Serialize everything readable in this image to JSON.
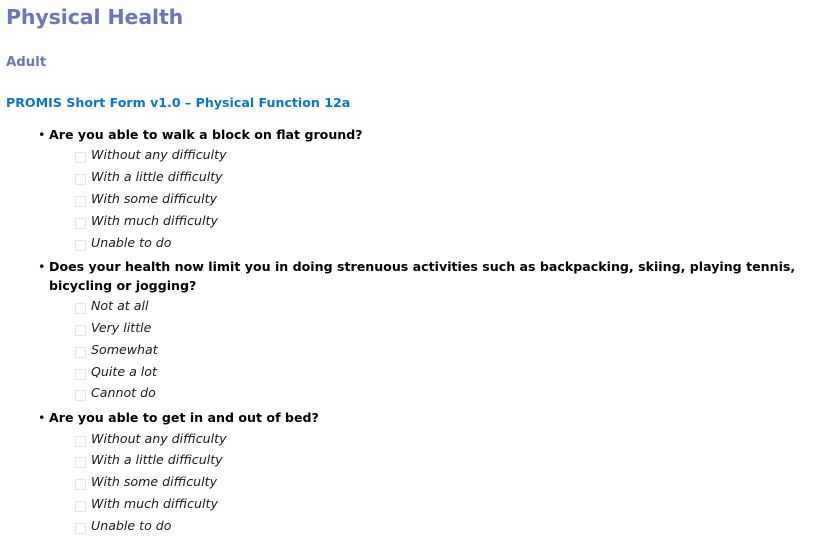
{
  "page": {
    "title": "Physical Health",
    "section": "Adult",
    "instrument": "PROMIS Short Form v1.0 – Physical Function 12a",
    "colors": {
      "title": "#6e76b5",
      "section": "#6e76b5",
      "instrument": "#0e76bc",
      "question_text": "#000000",
      "option_text": "#1a1a1a",
      "checkbox_border": "#b3b3b3",
      "background": "#ffffff"
    },
    "bullet_glyph": "•"
  },
  "questions": [
    {
      "text": "Are you able to walk a block on flat ground?",
      "options": [
        {
          "label": "Without any difficulty",
          "checked": false
        },
        {
          "label": "With a little difficulty",
          "checked": false
        },
        {
          "label": "With some difficulty",
          "checked": false
        },
        {
          "label": "With much difficulty",
          "checked": false
        },
        {
          "label": "Unable to do",
          "checked": false
        }
      ]
    },
    {
      "text": "Does your health now limit you in doing strenuous activities such as backpacking, skiing, playing tennis, bicycling or jogging?",
      "options": [
        {
          "label": "Not at all",
          "checked": false
        },
        {
          "label": "Very little",
          "checked": false
        },
        {
          "label": "Somewhat",
          "checked": false
        },
        {
          "label": "Quite a lot",
          "checked": false
        },
        {
          "label": "Cannot do",
          "checked": false
        }
      ]
    },
    {
      "text": "Are you able to get in and out of bed?",
      "options": [
        {
          "label": "Without any difficulty",
          "checked": false
        },
        {
          "label": "With a little difficulty",
          "checked": false
        },
        {
          "label": "With some difficulty",
          "checked": false
        },
        {
          "label": "With much difficulty",
          "checked": false
        },
        {
          "label": "Unable to do",
          "checked": false
        }
      ]
    }
  ]
}
